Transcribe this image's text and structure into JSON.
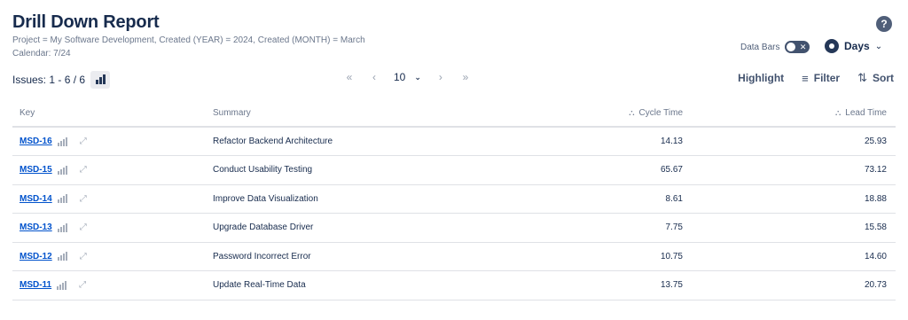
{
  "header": {
    "title": "Drill Down Report",
    "filter_line": "Project = My Software Development, Created (YEAR) = 2024, Created (MONTH) = March",
    "calendar_line": "Calendar: 7/24",
    "help_glyph": "?"
  },
  "controls": {
    "databars_label": "Data Bars",
    "databars_on": false,
    "days_label": "Days"
  },
  "toolbar": {
    "issues_label": "Issues: 1 - 6 / 6",
    "page_size": "10",
    "highlight_label": "Highlight",
    "filter_label": "Filter",
    "sort_label": "Sort"
  },
  "table": {
    "columns": {
      "key": "Key",
      "summary": "Summary",
      "cycle_time": "Cycle Time",
      "lead_time": "Lead Time"
    },
    "rows": [
      {
        "key": "MSD-16",
        "summary": "Refactor Backend Architecture",
        "cycle_time": "14.13",
        "lead_time": "25.93"
      },
      {
        "key": "MSD-15",
        "summary": "Conduct Usability Testing",
        "cycle_time": "65.67",
        "lead_time": "73.12"
      },
      {
        "key": "MSD-14",
        "summary": "Improve Data Visualization",
        "cycle_time": "8.61",
        "lead_time": "18.88"
      },
      {
        "key": "MSD-13",
        "summary": "Upgrade Database Driver",
        "cycle_time": "7.75",
        "lead_time": "15.58"
      },
      {
        "key": "MSD-12",
        "summary": "Password Incorrect Error",
        "cycle_time": "10.75",
        "lead_time": "14.60"
      },
      {
        "key": "MSD-11",
        "summary": "Update Real-Time Data",
        "cycle_time": "13.75",
        "lead_time": "20.73"
      }
    ]
  },
  "colors": {
    "link": "#0052cc",
    "text": "#172b4d",
    "muted": "#6b778c"
  }
}
